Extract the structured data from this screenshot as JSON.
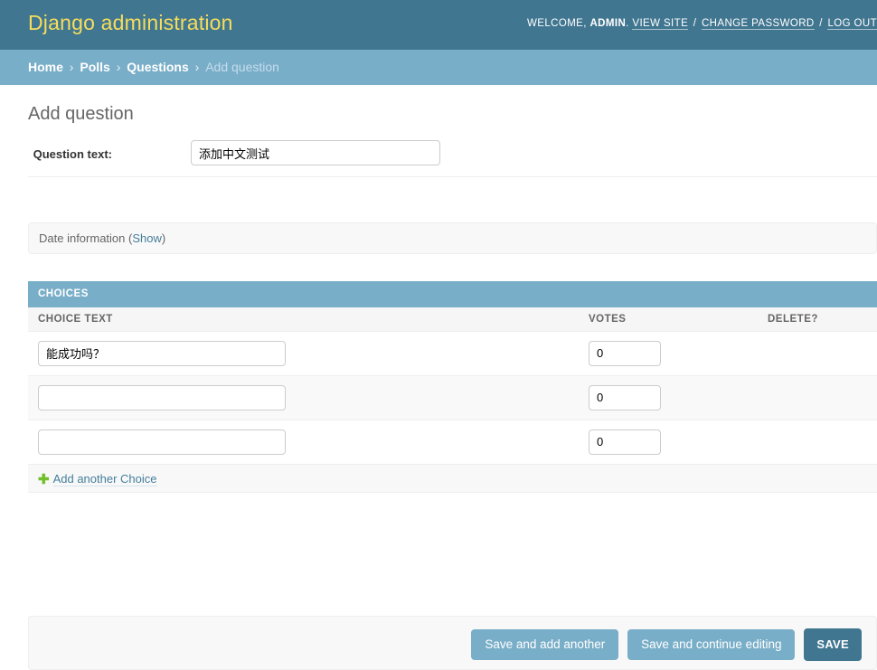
{
  "header": {
    "site_name": "Django administration",
    "welcome_prefix": "WELCOME,",
    "username": "ADMIN",
    "welcome_suffix": ".",
    "view_site": "VIEW SITE",
    "change_password": "CHANGE PASSWORD",
    "log_out": "LOG OUT",
    "separator": "/",
    "brand_color": "#f5dd5d",
    "background_color": "#417690"
  },
  "breadcrumbs": {
    "separator": "›",
    "items": [
      {
        "label": "Home",
        "current": false
      },
      {
        "label": "Polls",
        "current": false
      },
      {
        "label": "Questions",
        "current": false
      },
      {
        "label": "Add question",
        "current": true
      }
    ],
    "background_color": "#79aec8"
  },
  "page": {
    "title": "Add question"
  },
  "form": {
    "question_row": {
      "label": "Question text:",
      "value": "添加中文测试"
    },
    "date_fieldset": {
      "legend": "Date information",
      "open_paren": "(",
      "toggle_label": "Show",
      "close_paren": ")"
    }
  },
  "inline": {
    "heading": "CHOICES",
    "columns": {
      "choice_text": "CHOICE TEXT",
      "votes": "VOTES",
      "delete": "DELETE?"
    },
    "rows": [
      {
        "choice_text": "能成功吗？",
        "votes": "0",
        "delete": ""
      },
      {
        "choice_text": "",
        "votes": "0",
        "delete": ""
      },
      {
        "choice_text": "",
        "votes": "0",
        "delete": ""
      }
    ],
    "add_row": {
      "icon": "plus-icon",
      "glyph": "✚",
      "label": "Add another Choice",
      "icon_color": "#70bf2b"
    }
  },
  "submit_row": {
    "save_and_add_another": "Save and add another",
    "save_and_continue": "Save and continue editing",
    "save": "SAVE",
    "default_button_color": "#417690",
    "button_color": "#79aec8"
  }
}
